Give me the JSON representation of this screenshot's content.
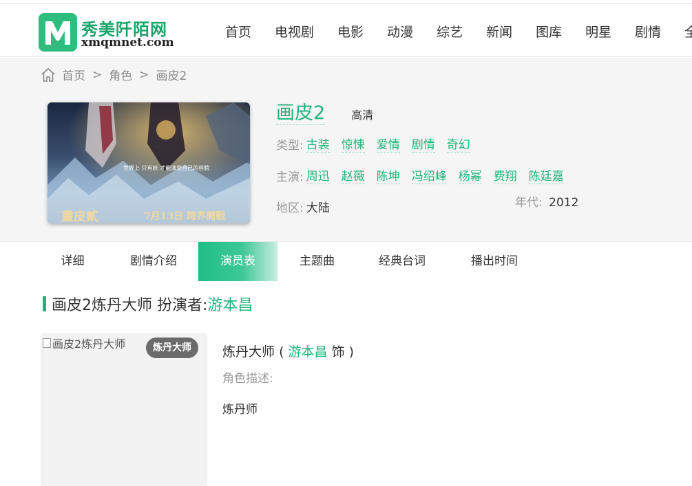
{
  "site": {
    "name": "秀美阡陌网",
    "domain": "xmqmnet.com",
    "logo_letter": "M"
  },
  "nav": {
    "items": [
      "首页",
      "电视剧",
      "电影",
      "动漫",
      "综艺",
      "新闻",
      "图库",
      "明星",
      "剧情",
      "全"
    ]
  },
  "breadcrumb": {
    "home": "首页",
    "sep": ">",
    "category": "角色",
    "current": "画皮2"
  },
  "movie": {
    "title": "画皮2",
    "quality": "高清",
    "genre_label": "类型:",
    "genres": [
      "古装",
      "惊悚",
      "爱情",
      "剧情",
      "奇幻"
    ],
    "cast_label": "主演:",
    "cast": [
      "周迅",
      "赵薇",
      "陈坤",
      "冯绍峰",
      "杨幂",
      "费翔",
      "陈廷嘉"
    ],
    "region_label": "地区:",
    "region": "大陆",
    "year_label": "年代:",
    "year": "2012",
    "poster_text": {
      "tagline": "世界上 只有妖 才能演变自己的容貌",
      "date": "7月13日 跨界開戰"
    }
  },
  "tabs": [
    {
      "label": "详细",
      "active": false
    },
    {
      "label": "剧情介绍",
      "active": false
    },
    {
      "label": "演员表",
      "active": true
    },
    {
      "label": "主题曲",
      "active": false
    },
    {
      "label": "经典台词",
      "active": false
    },
    {
      "label": "播出时间",
      "active": false
    }
  ],
  "section": {
    "title": "画皮2炼丹大师 扮演者:",
    "actor": "游本昌"
  },
  "role": {
    "image_alt": "画皮2炼丹大师",
    "badge": "炼丹大师",
    "name": "炼丹大师",
    "paren_open": "(",
    "actor": "游本昌",
    "suffix": "饰 )",
    "desc_label": "角色描述:",
    "desc": "炼丹师"
  },
  "colors": {
    "accent": "#1fb57a",
    "hero_bg": "#f5f5f5",
    "badge_bg": "#6b6b6b"
  }
}
